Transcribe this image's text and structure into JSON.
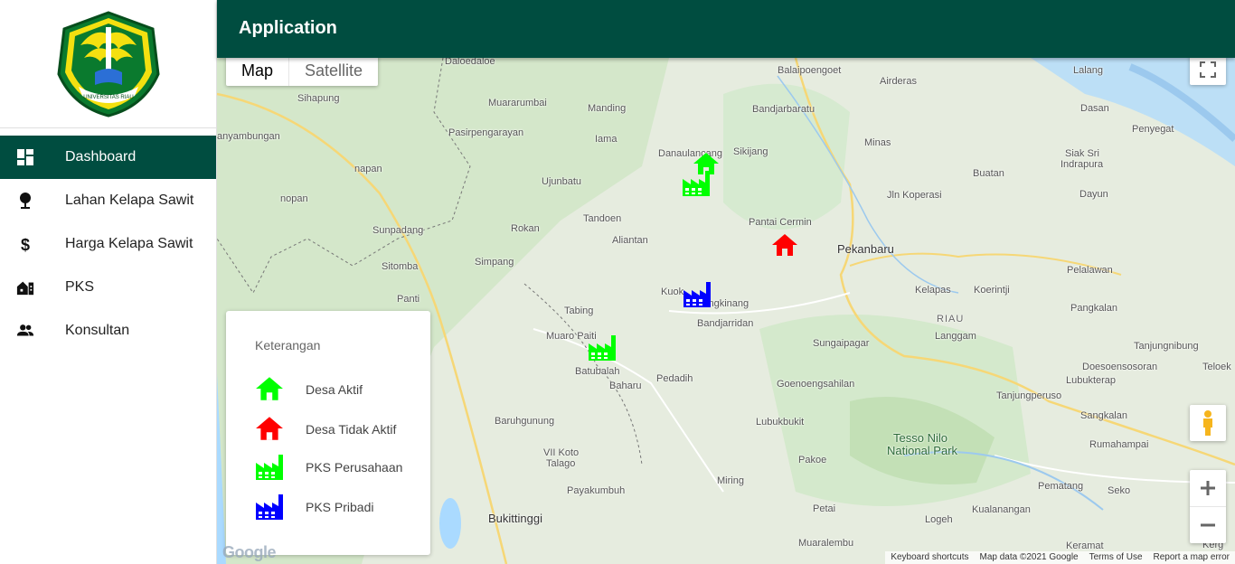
{
  "app": {
    "title": "Application"
  },
  "sidebar": {
    "logo_alt": "UNIVERSITAS RIAU",
    "items": [
      {
        "label": "Dashboard",
        "icon": "dashboard-icon",
        "active": true
      },
      {
        "label": "Lahan Kelapa Sawit",
        "icon": "map-pin-icon"
      },
      {
        "label": "Harga Kelapa Sawit",
        "icon": "dollar-icon"
      },
      {
        "label": "PKS",
        "icon": "factory-building-icon"
      },
      {
        "label": "Konsultan",
        "icon": "people-icon"
      }
    ]
  },
  "map": {
    "type_buttons": {
      "map": "Map",
      "satellite": "Satellite"
    },
    "places": [
      "Daloedaloe",
      "Balaipoengoet",
      "Lalang",
      "Airderas",
      "Muararumbai",
      "Manding",
      "Bandjarbaratu",
      "Dasan",
      "Sihapung",
      "Pasirpengarayan",
      "Iama",
      "Sikijang",
      "Penyegat",
      "anyambungan",
      "Minas",
      "Siak Sri",
      "Indrapura",
      "Danaulancang",
      "napan",
      "Ujunbatu",
      "Buatan",
      "Jln Koperasi",
      "Dayun",
      "nopan",
      "Tandoen",
      "Pantai Cermin",
      "Rokan",
      "Sunpadang",
      "Aliantan",
      "Pekanbaru",
      "Simpang",
      "Pelalawan",
      "Sitomba",
      "Kuok",
      "Bangkinang",
      "Kelapas",
      "Koerintji",
      "Panti",
      "Bandjarridan",
      "Pangkalan",
      "Tabing",
      "RIAU",
      "Langgam",
      "Muaro Paiti",
      "Sungaipagar",
      "Tanjungnibung",
      "Batubalah",
      "Lubukterap",
      "Doesoensosoran",
      "Teloek",
      "Baharu",
      "Pedadih",
      "Goenoengsahilan",
      "Tanjungperuso",
      "Baruhgunung",
      "Lubukbukit",
      "Sangkalan",
      "Tesso Nilo",
      "National Park",
      "Rumahampai",
      "VII Koto",
      "Talago",
      "Pakoe",
      "Payakumbuh",
      "Miring",
      "Pematang",
      "Seko",
      "Bukittinggi",
      "Petai",
      "Logeh",
      "Kualanangan",
      "Muaralembu",
      "Keramat",
      "Kerg"
    ],
    "footer": {
      "shortcuts": "Keyboard shortcuts",
      "mapdata": "Map data ©2021 Google",
      "terms": "Terms of Use",
      "report": "Report a map error"
    },
    "google_logo": "Google"
  },
  "legend": {
    "title": "Keterangan",
    "items": [
      {
        "label": "Desa Aktif",
        "icon": "house-icon",
        "color": "#00ff00"
      },
      {
        "label": "Desa Tidak Aktif",
        "icon": "house-icon",
        "color": "#ff0000"
      },
      {
        "label": "PKS Perusahaan",
        "icon": "factory-icon",
        "color": "#00ff00"
      },
      {
        "label": "PKS Pribadi",
        "icon": "factory-icon",
        "color": "#0000ff"
      }
    ]
  },
  "colors": {
    "primary": "#004d40",
    "green": "#00ff00",
    "red": "#ff0000",
    "blue": "#0000ff"
  }
}
